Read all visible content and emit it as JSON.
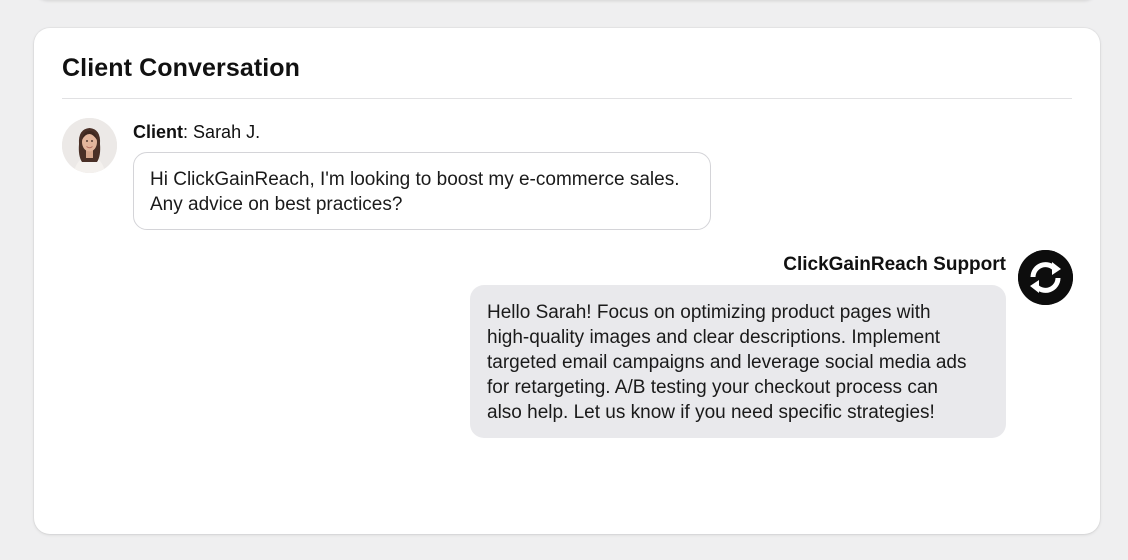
{
  "card": {
    "title": "Client Conversation"
  },
  "client": {
    "role_label": "Client",
    "separator": ":",
    "name": "Sarah J.",
    "avatar_icon": "client-avatar-photo",
    "message_lines": [
      "Hi ClickGainReach, I'm looking to boost my e-commerce sales.",
      "Any advice on best practices?"
    ]
  },
  "support": {
    "name": "ClickGainReach Support",
    "avatar_icon": "sync-logo-icon",
    "message_lines": [
      "Hello Sarah! Focus on optimizing product pages with",
      "high-quality images and clear descriptions. Implement",
      "targeted email campaigns and leverage social media ads",
      "for retargeting. A/B testing your checkout process can",
      "also help. Let us know if you need specific strategies!"
    ]
  },
  "colors": {
    "page_background": "#efeff0",
    "card_background": "#ffffff",
    "client_bubble_border": "#d4d4d8",
    "support_bubble_background": "#e9e9ec",
    "support_avatar_background": "#0d0d0d"
  }
}
